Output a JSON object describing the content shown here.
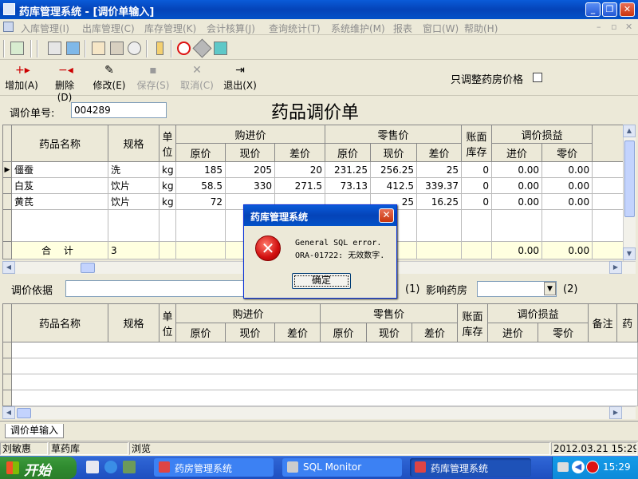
{
  "window": {
    "title": "药库管理系统 - [调价单输入]"
  },
  "menu": [
    "入库管理(I)",
    "出库管理(C)",
    "库存管理(K)",
    "会计核算(J)",
    "查询统计(T)",
    "系统维护(M)",
    "报表",
    "窗口(W)",
    "帮助(H)"
  ],
  "actions": {
    "add": "增加(A)",
    "delete": "删除(D)",
    "modify": "修改(E)",
    "save": "保存(S)",
    "cancel": "取消(C)",
    "exit": "退出(X)"
  },
  "options": {
    "pharmacy_price_only": "只调整药房价格"
  },
  "form": {
    "number_label": "调价单号:",
    "number_value": "004289",
    "title": "药品调价单",
    "basis_label": "调价依据",
    "basis_value": "",
    "marker1": "(1)",
    "affect_label": "影响药房",
    "affect_value": "",
    "marker2": "(2)"
  },
  "grid_headers": {
    "name": "药品名称",
    "spec": "规格",
    "unit": "单位",
    "purchase": "购进价",
    "retail": "零售价",
    "stock": "账面库存",
    "gainloss": "调价损益",
    "old": "原价",
    "new": "现价",
    "diff": "差价",
    "in_price": "进价",
    "retail_price": "零价",
    "remark": "备注",
    "extra": "药"
  },
  "rows": [
    {
      "name": "僵蚕",
      "spec": "洗",
      "unit": "kg",
      "p_old": "185",
      "p_new": "205",
      "p_diff": "20",
      "r_old": "231.25",
      "r_new": "256.25",
      "r_diff": "25",
      "stock": "0",
      "g_in": "0.00",
      "g_retail": "0.00"
    },
    {
      "name": "白芨",
      "spec": "饮片",
      "unit": "kg",
      "p_old": "58.5",
      "p_new": "330",
      "p_diff": "271.5",
      "r_old": "73.13",
      "r_new": "412.5",
      "r_diff": "339.37",
      "stock": "0",
      "g_in": "0.00",
      "g_retail": "0.00"
    },
    {
      "name": "黄芪",
      "spec": "饮片",
      "unit": "kg",
      "p_old": "72",
      "p_new": "",
      "p_diff": "",
      "r_old": "",
      "r_new": "25",
      "r_diff": "16.25",
      "stock": "0",
      "g_in": "0.00",
      "g_retail": "0.00"
    }
  ],
  "total": {
    "label": "合 计",
    "count": "3",
    "g_in": "0.00",
    "g_retail": "0.00"
  },
  "tab": "调价单输入",
  "status": {
    "user": "刘敏惠",
    "store": "草药库",
    "mode": "浏览",
    "datetime": "2012.03.21 15:29:2"
  },
  "dialog": {
    "title": "药库管理系统",
    "line1": "General SQL error.",
    "line2": "ORA-01722: 无效数字.",
    "ok": "确定"
  },
  "taskbar": {
    "start": "开始",
    "tasks": [
      "药房管理系统",
      "SQL Monitor",
      "药库管理系统"
    ],
    "clock": "15:29"
  }
}
